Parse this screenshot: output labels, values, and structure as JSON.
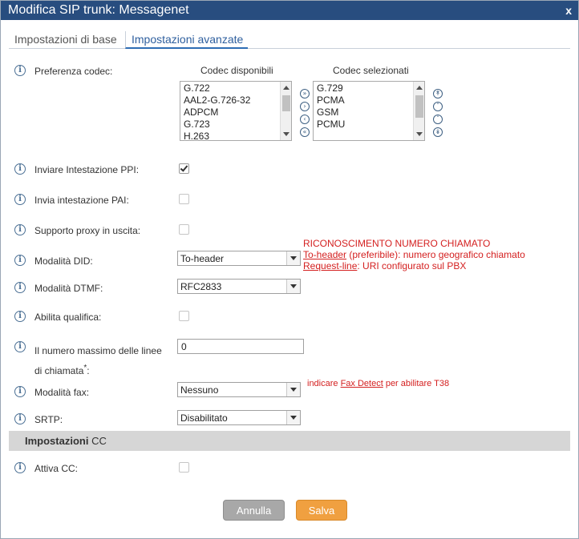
{
  "window": {
    "title": "Modifica SIP trunk: Messagenet",
    "close_label": "x"
  },
  "tabs": [
    {
      "label": "Impostazioni di base"
    },
    {
      "label": "Impostazioni avanzate"
    }
  ],
  "codec": {
    "label": "Preferenza codec:",
    "available_header": "Codec disponibili",
    "selected_header": "Codec selezionati",
    "available": [
      "G.722",
      "AAL2-G.726-32",
      "ADPCM",
      "G.723",
      "H.263"
    ],
    "selected": [
      "G.729",
      "PCMA",
      "GSM",
      "PCMU"
    ]
  },
  "fields": {
    "ppi": {
      "label": "Inviare Intestazione PPI:",
      "checked": true
    },
    "pai": {
      "label": "Invia intestazione PAI:",
      "checked": false
    },
    "proxy": {
      "label": "Supporto proxy in uscita:",
      "checked": false
    },
    "did": {
      "label": "Modalità DID:",
      "value": "To-header"
    },
    "dtmf": {
      "label": "Modalità DTMF:",
      "value": "RFC2833"
    },
    "qualify": {
      "label": "Abilita qualifica:",
      "checked": false
    },
    "maxlines": {
      "label_line1": "Il numero massimo delle linee",
      "label_line2": "di chiamata",
      "required_mark": "*",
      "colon": ":",
      "value": "0"
    },
    "fax": {
      "label": "Modalità fax:",
      "value": "Nessuno"
    },
    "srtp": {
      "label": "SRTP:",
      "value": "Disabilitato"
    },
    "cc": {
      "label": "Attiva CC:",
      "checked": false
    }
  },
  "notes": {
    "did_title": "RICONOSCIMENTO NUMERO CHIAMATO",
    "did_opt1_key": "To-header",
    "did_opt1_text": " (preferibile): numero geografico chiamato",
    "did_opt2_key": "Request-line",
    "did_opt2_text": ": URI configurato sul PBX",
    "fax_pre": "indicare ",
    "fax_key": "Fax Detect",
    "fax_post": " per abilitare T38"
  },
  "section": {
    "title_bold": "Impostazioni",
    "title_rest": " CC"
  },
  "buttons": {
    "cancel": "Annulla",
    "save": "Salva"
  },
  "colors": {
    "titlebar": "#284d7f",
    "save": "#f0a040",
    "cancel": "#a8a8a8",
    "note": "#d42020"
  }
}
